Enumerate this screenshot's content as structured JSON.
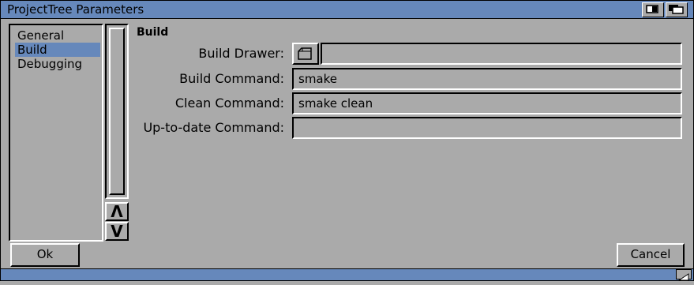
{
  "window": {
    "title": "ProjectTree Parameters"
  },
  "list": {
    "items": [
      {
        "label": "General",
        "selected": false
      },
      {
        "label": "Build",
        "selected": true
      },
      {
        "label": "Debugging",
        "selected": false
      }
    ]
  },
  "scroll": {
    "up_label": "Λ",
    "down_label": "V"
  },
  "form": {
    "section_title": "Build",
    "fields": [
      {
        "label": "Build Drawer:",
        "value": ""
      },
      {
        "label": "Build Command:",
        "value": "smake"
      },
      {
        "label": "Clean Command:",
        "value": "smake clean"
      },
      {
        "label": "Up-to-date Command:",
        "value": ""
      }
    ]
  },
  "buttons": {
    "ok": "Ok",
    "cancel": "Cancel"
  },
  "colors": {
    "background": "#aaaaaa",
    "titlebar": "#6688bb",
    "selection": "#6688bb"
  }
}
